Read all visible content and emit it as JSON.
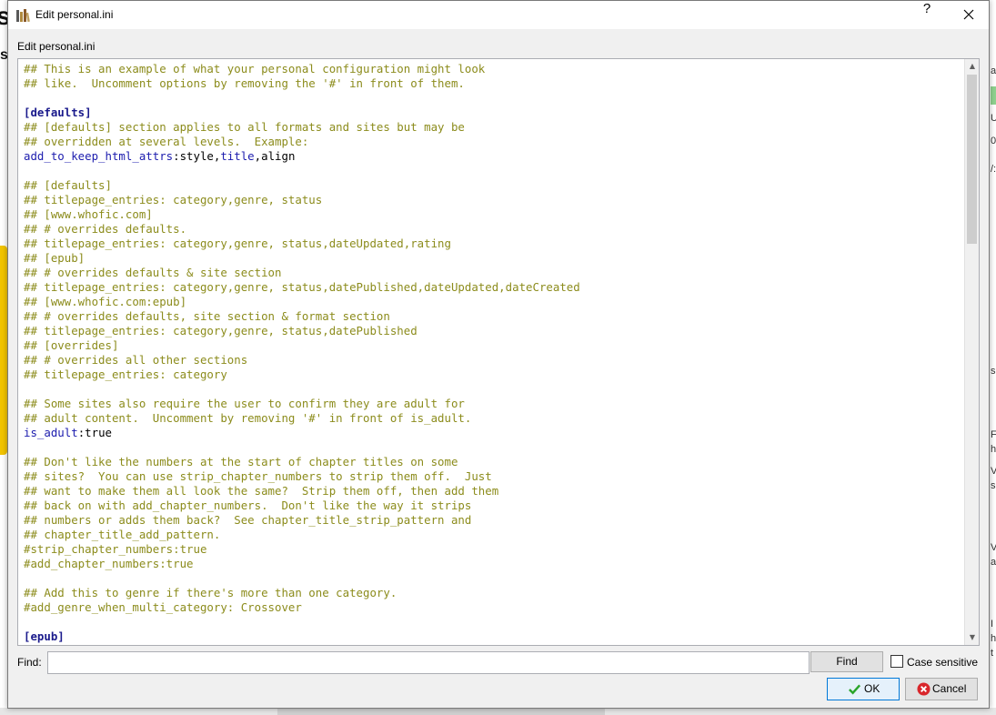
{
  "window": {
    "title": "Edit personal.ini",
    "help_label": "?",
    "caption": "Edit personal.ini"
  },
  "editor": {
    "lines": [
      [
        {
          "t": "## This is an example of what your personal configuration might look",
          "k": "c"
        }
      ],
      [
        {
          "t": "## like.  Uncomment options by removing the '#' in front of them.",
          "k": "c"
        }
      ],
      [],
      [
        {
          "t": "[defaults]",
          "k": "sec"
        }
      ],
      [
        {
          "t": "## [defaults] section applies to all formats and sites but may be",
          "k": "c"
        }
      ],
      [
        {
          "t": "## overridden at several levels.  Example:",
          "k": "c"
        }
      ],
      [
        {
          "t": "add_to_keep_html_attrs",
          "k": "key"
        },
        {
          "t": ":style,",
          "k": "val"
        },
        {
          "t": "title",
          "k": "key"
        },
        {
          "t": ",align",
          "k": "val"
        }
      ],
      [],
      [
        {
          "t": "## [defaults]",
          "k": "c"
        }
      ],
      [
        {
          "t": "## titlepage_entries: category,genre, status",
          "k": "c"
        }
      ],
      [
        {
          "t": "## [www.whofic.com]",
          "k": "c"
        }
      ],
      [
        {
          "t": "## # overrides defaults.",
          "k": "c"
        }
      ],
      [
        {
          "t": "## titlepage_entries: category,genre, status,dateUpdated,rating",
          "k": "c"
        }
      ],
      [
        {
          "t": "## [epub]",
          "k": "c"
        }
      ],
      [
        {
          "t": "## # overrides defaults & site section",
          "k": "c"
        }
      ],
      [
        {
          "t": "## titlepage_entries: category,genre, status,datePublished,dateUpdated,dateCreated",
          "k": "c"
        }
      ],
      [
        {
          "t": "## [www.whofic.com:epub]",
          "k": "c"
        }
      ],
      [
        {
          "t": "## # overrides defaults, site section & format section",
          "k": "c"
        }
      ],
      [
        {
          "t": "## titlepage_entries: category,genre, status,datePublished",
          "k": "c"
        }
      ],
      [
        {
          "t": "## [overrides]",
          "k": "c"
        }
      ],
      [
        {
          "t": "## # overrides all other sections",
          "k": "c"
        }
      ],
      [
        {
          "t": "## titlepage_entries: category",
          "k": "c"
        }
      ],
      [],
      [
        {
          "t": "## Some sites also require the user to confirm they are adult for",
          "k": "c"
        }
      ],
      [
        {
          "t": "## adult content.  Uncomment by removing '#' in front of is_adult.",
          "k": "c"
        }
      ],
      [
        {
          "t": "is_adult",
          "k": "key"
        },
        {
          "t": ":true",
          "k": "val"
        }
      ],
      [],
      [
        {
          "t": "## Don't like the numbers at the start of chapter titles on some",
          "k": "c"
        }
      ],
      [
        {
          "t": "## sites?  You can use strip_chapter_numbers to strip them off.  Just",
          "k": "c"
        }
      ],
      [
        {
          "t": "## want to make them all look the same?  Strip them off, then add them",
          "k": "c"
        }
      ],
      [
        {
          "t": "## back on with add_chapter_numbers.  Don't like the way it strips",
          "k": "c"
        }
      ],
      [
        {
          "t": "## numbers or adds them back?  See chapter_title_strip_pattern and",
          "k": "c"
        }
      ],
      [
        {
          "t": "## chapter_title_add_pattern.",
          "k": "c"
        }
      ],
      [
        {
          "t": "#strip_chapter_numbers:true",
          "k": "c"
        }
      ],
      [
        {
          "t": "#add_chapter_numbers:true",
          "k": "c"
        }
      ],
      [],
      [
        {
          "t": "## Add this to genre if there's more than one category.",
          "k": "c"
        }
      ],
      [
        {
          "t": "#add_genre_when_multi_category: Crossover",
          "k": "c"
        }
      ],
      [],
      [
        {
          "t": "[epub]",
          "k": "sec"
        }
      ]
    ]
  },
  "find": {
    "label": "Find:",
    "value": "",
    "button_label": "Find",
    "case_label": "Case sensitive",
    "case_checked": false
  },
  "buttons": {
    "ok_label": "OK",
    "cancel_label": "Cancel"
  },
  "background": {
    "left_glyph": "s",
    "left_glyph2": "s",
    "right_texts": [
      "al",
      "U",
      "0",
      "/:",
      "s",
      "F",
      "h",
      "V",
      "s",
      "V",
      "a",
      "I",
      "h",
      "t"
    ]
  },
  "colors": {
    "comment": "#8c8c1c",
    "section": "#1a1a8c",
    "key": "#1c1cae",
    "ok_border": "#0078d7",
    "cancel_icon": "#d9262b",
    "ok_check": "#2aa52a"
  },
  "icons": {
    "app": "bookshelf-icon",
    "close": "close-icon",
    "ok": "check-icon",
    "cancel": "cancel-x-icon"
  }
}
